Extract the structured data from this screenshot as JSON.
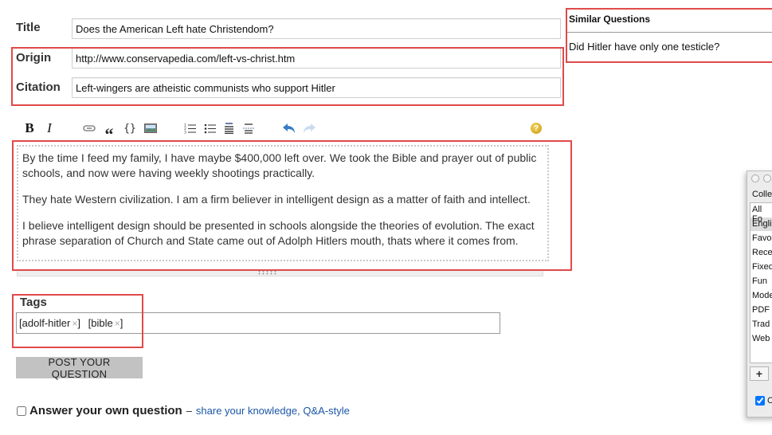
{
  "form": {
    "title_label": "Title",
    "title_value": "Does the American Left hate Christendom?",
    "origin_label": "Origin",
    "origin_value": "http://www.conservapedia.com/left-vs-christ.htm",
    "citation_label": "Citation",
    "citation_value": "Left-wingers are atheistic communists who support Hitler"
  },
  "toolbar": {
    "bold": "B",
    "italic": "I",
    "icons": [
      "link-icon",
      "blockquote-icon",
      "code-icon",
      "image-icon",
      "numbered-list-icon",
      "bulleted-list-icon",
      "heading-icon",
      "horizontal-rule-icon",
      "undo-icon",
      "redo-icon",
      "help-icon"
    ],
    "quote_glyph": "“",
    "code_glyph": "{}",
    "help_glyph": "?"
  },
  "editor": {
    "paragraphs": [
      "By the time I feed my family, I have maybe $400,000 left over. We took the Bible and prayer out of public schools, and now were having weekly shootings practically.",
      "They hate Western civilization. I am a firm believer in intelligent design as a matter of faith and intellect.",
      "I believe intelligent design should be presented in schools alongside the theories of evolution. The exact phrase separation of Church and State came out of Adolph Hitlers mouth, thats where it comes from."
    ]
  },
  "tags": {
    "label": "Tags",
    "items": [
      {
        "name": "adolf-hitler",
        "remove": "×"
      },
      {
        "name": "bible",
        "remove": "×"
      }
    ]
  },
  "post_button": "POST YOUR QUESTION",
  "answer_own": {
    "label": "Answer your own question",
    "dash": "–",
    "link": "share your knowledge, Q&A-style",
    "checked": false
  },
  "similar": {
    "title": "Similar Questions",
    "items": [
      "Did Hitler have only one testicle?"
    ]
  },
  "side_window": {
    "header": "Colle",
    "items": [
      "All Fo",
      "Engli",
      "Favo",
      "Rece",
      "Fixed",
      "Fun",
      "Mode",
      "PDF",
      "Trad",
      "Web"
    ],
    "selected_index": 1,
    "add_button": "+",
    "checkbox_label": "C",
    "checkbox_checked": true
  },
  "colors": {
    "highlight_red": "#e04a4a",
    "link_blue": "#1a56a6",
    "button_gray": "#c2c2c2"
  }
}
